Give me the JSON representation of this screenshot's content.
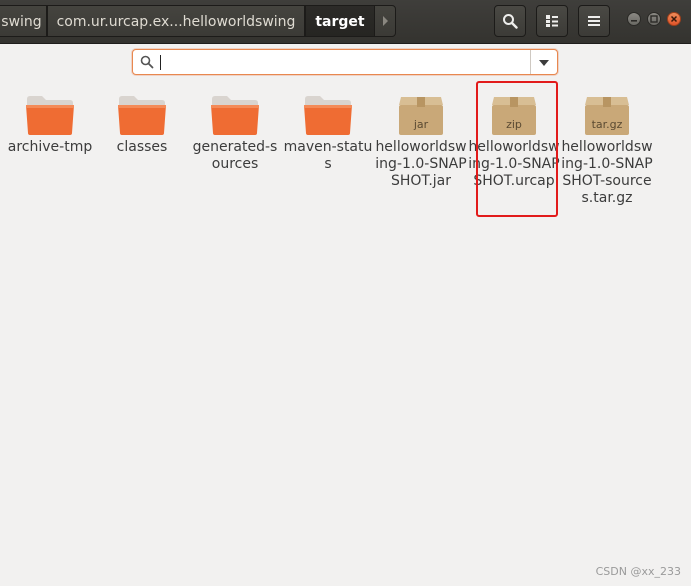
{
  "breadcrumbs": [
    {
      "label": "swing"
    },
    {
      "label": "com.ur.urcap.ex...helloworldswing"
    },
    {
      "label": "target"
    }
  ],
  "search": {
    "value": "",
    "placeholder": ""
  },
  "files": [
    {
      "name": "archive-tmp",
      "type": "folder",
      "icon": "folder-icon"
    },
    {
      "name": "classes",
      "type": "folder",
      "icon": "folder-icon"
    },
    {
      "name": "generated-sources",
      "type": "folder",
      "icon": "folder-icon"
    },
    {
      "name": "maven-status",
      "type": "folder",
      "icon": "folder-icon"
    },
    {
      "name": "helloworldswing-1.0-SNAPSHOT.jar",
      "type": "package",
      "icon": "package-icon",
      "badge": "jar"
    },
    {
      "name": "helloworldswing-1.0-SNAPSHOT.urcap",
      "type": "package",
      "icon": "package-icon",
      "badge": "zip"
    },
    {
      "name": "helloworldswing-1.0-SNAPSHOT-sources.tar.gz",
      "type": "package",
      "icon": "package-icon",
      "badge": "tar.gz"
    }
  ],
  "watermark": "CSDN @xx_233",
  "colors": {
    "accent": "#e95420",
    "folder": "#ef6c33",
    "package": "#c9a878",
    "highlight": "#e21b1b"
  }
}
